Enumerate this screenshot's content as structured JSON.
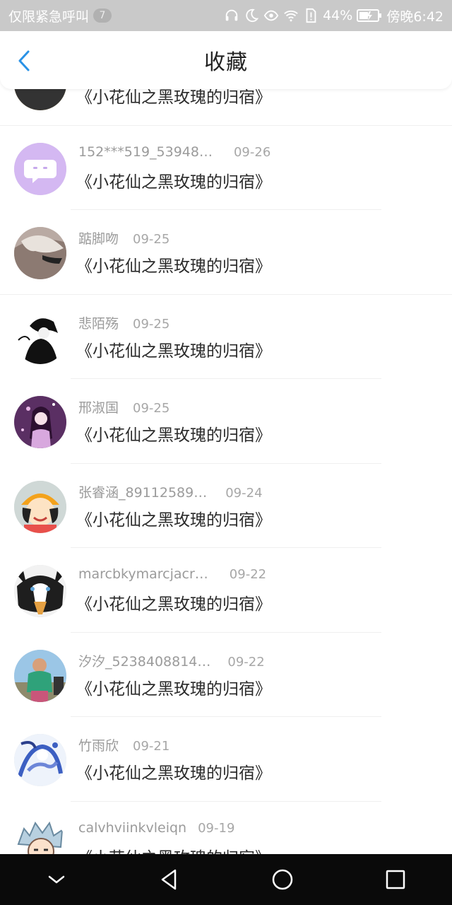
{
  "status_bar": {
    "carrier": "仅限紧急呼叫",
    "notification_count": "7",
    "battery": "44%",
    "time": "傍晚6:42",
    "icons": [
      "headset-icon",
      "moon-icon",
      "eye-icon",
      "wifi-icon",
      "sim-alert-icon",
      "battery-icon"
    ]
  },
  "header": {
    "title": "收藏",
    "back_icon": "chevron-left-icon",
    "accent_color": "#2a92e6"
  },
  "items": [
    {
      "name": "",
      "date": "",
      "title": "《小花仙之黑玫瑰的归宿》",
      "avatar": "avatar-partial"
    },
    {
      "name": "152***519_53948…",
      "date": "09-26",
      "title": "《小花仙之黑玫瑰的归宿》",
      "avatar": "chat-bubble-avatar"
    },
    {
      "name": "踮脚吻",
      "date": "09-25",
      "title": "《小花仙之黑玫瑰的归宿》",
      "avatar": "photo-avatar"
    },
    {
      "name": "悲陌殇",
      "date": "09-25",
      "title": "《小花仙之黑玫瑰的归宿》",
      "avatar": "photo-avatar"
    },
    {
      "name": "邢淑国",
      "date": "09-25",
      "title": "《小花仙之黑玫瑰的归宿》",
      "avatar": "photo-avatar"
    },
    {
      "name": "张睿涵_89112589…",
      "date": "09-24",
      "title": "《小花仙之黑玫瑰的归宿》",
      "avatar": "photo-avatar"
    },
    {
      "name": "marcbkymarcjacr…",
      "date": "09-22",
      "title": "《小花仙之黑玫瑰的归宿》",
      "avatar": "photo-avatar"
    },
    {
      "name": "汐汐_5238408814…",
      "date": "09-22",
      "title": "《小花仙之黑玫瑰的归宿》",
      "avatar": "photo-avatar"
    },
    {
      "name": "竹雨欣",
      "date": "09-21",
      "title": "《小花仙之黑玫瑰的归宿》",
      "avatar": "photo-avatar"
    },
    {
      "name": "calvhviinkvleiqn",
      "date": "09-19",
      "title": "《小花仙之黑玫瑰的归宿》",
      "avatar": "photo-avatar"
    }
  ],
  "nav_bar": {
    "icons": [
      "chevron-down-icon",
      "back-triangle-icon",
      "home-circle-icon",
      "recents-square-icon"
    ]
  }
}
